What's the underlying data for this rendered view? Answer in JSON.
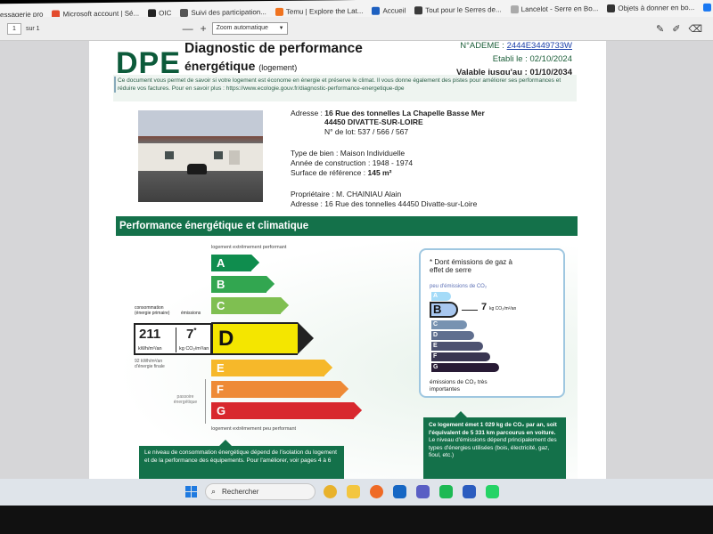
{
  "bookmarks": [
    {
      "label": "essagerie pro",
      "color": "#2f73c9"
    },
    {
      "label": "Microsoft account | Sé...",
      "color": "#e34b2d"
    },
    {
      "label": "OIC",
      "color": "#222222"
    },
    {
      "label": "Suivi des participation...",
      "color": "#555555"
    },
    {
      "label": "Temu | Explore the Lat...",
      "color": "#f0731f"
    },
    {
      "label": "Accueil",
      "color": "#1e60c0"
    },
    {
      "label": "Tout pour le Serres de...",
      "color": "#3a3a3a"
    },
    {
      "label": "Lancelot - Serre en Bo...",
      "color": "#aaaaaa"
    },
    {
      "label": "Objets à donner en bo...",
      "color": "#333333"
    },
    {
      "label": "Facebook",
      "color": "#1877f2"
    }
  ],
  "pdf_toolbar": {
    "page_number": "1",
    "page_of": "sur 1",
    "zoom_out": "—",
    "zoom_in": "+",
    "zoom": "Zoom automatique"
  },
  "document": {
    "logo": "DPE",
    "title_line1": "Diagnostic de performance",
    "title_line2": "énergétique",
    "title_sub": "(logement)",
    "ademe_label": "N°ADEME :",
    "ademe_value": "2444E3449733W",
    "etabli": "Etabli le : 02/10/2024",
    "valable": "Valable jusqu'au : 01/10/2034",
    "intro": "Ce document vous permet de savoir si votre logement est économe en énergie et préserve le climat. Il vous donne également des pistes pour améliorer ses performances et réduire vos factures. Pour en savoir plus : https://www.ecologie.gouv.fr/diagnostic-performance-energetique-dpe",
    "address_label": "Adresse :",
    "address_line1": "16 Rue des tonnelles La Chapelle Basse Mer",
    "address_line2": "44450 DIVATTE-SUR-LOIRE",
    "lot": "N° de lot: 537 / 566 / 567",
    "type_bien_label": "Type de bien :",
    "type_bien": "Maison Individuelle",
    "annee_label": "Année de construction :",
    "annee": "1948 - 1974",
    "surface_label": "Surface de référence :",
    "surface": "145 m²",
    "proprio_label": "Propriétaire :",
    "proprio": "M. CHAINIAU Alain",
    "address2_label": "Adresse :",
    "address2": "16 Rue des tonnelles 44450 Divatte-sur-Loire"
  },
  "performance": {
    "band_title": "Performance énergétique et climatique",
    "top_label": "logement extrêmement performant",
    "bottom_label": "logement extrêmement peu performant",
    "classes": [
      {
        "letter": "A",
        "color": "#0f8d4e"
      },
      {
        "letter": "B",
        "color": "#32a650"
      },
      {
        "letter": "C",
        "color": "#7fbf51"
      },
      {
        "letter": "D",
        "color": "#f4e600"
      },
      {
        "letter": "E",
        "color": "#f6b82a"
      },
      {
        "letter": "F",
        "color": "#ee8a37"
      },
      {
        "letter": "G",
        "color": "#d8282e"
      }
    ],
    "current_class": "D",
    "consumption_label": "consommation (énergie primaire)",
    "emissions_label": "émissions",
    "consumption_value": "211",
    "consumption_unit": "kWh/m²/an",
    "emissions_value": "7",
    "emissions_mark": "*",
    "emissions_unit": "kg CO₂/m²/an",
    "final_label": "92 kWh/m²/an d'énergie finale",
    "passoire_label": "passoire énergétique",
    "note_left": "Le niveau de consommation énergétique dépend de l'isolation du logement et de la performance des équipements. Pour l'améliorer, voir pages 4 à 6"
  },
  "ges": {
    "title": "* Dont émissions de gaz à effet de serre",
    "top_label": "peu d'émissions de CO₂",
    "classes": [
      {
        "letter": "A",
        "color": "#a4dbf8"
      },
      {
        "letter": "B",
        "color": "#8cb4d3"
      },
      {
        "letter": "C",
        "color": "#7792b1"
      },
      {
        "letter": "D",
        "color": "#606f8f"
      },
      {
        "letter": "E",
        "color": "#4d5271"
      },
      {
        "letter": "F",
        "color": "#393551"
      },
      {
        "letter": "G",
        "color": "#281b35"
      }
    ],
    "current_class": "B",
    "value": "7",
    "unit": "kg CO₂/m²/an",
    "bottom_label": "émissions de CO₂ très importantes",
    "note_bold": "Ce logement émet 1 029 kg de CO₂ par an, soit l'équivalent de 5 331 km parcourus en voiture.",
    "note_rest": "Le niveau d'émissions dépend principalement des types d'énergies utilisées (bois, électricité, gaz, fioul, etc.)"
  },
  "taskbar": {
    "search_placeholder": "Rechercher",
    "apps": [
      {
        "name": "chrome-icon",
        "color": "#e8b22c"
      },
      {
        "name": "file-explorer-icon",
        "color": "#f3c640"
      },
      {
        "name": "firefox-icon",
        "color": "#ef6a25"
      },
      {
        "name": "outlook-icon",
        "color": "#1667c4"
      },
      {
        "name": "teams-icon",
        "color": "#5a5fc4"
      },
      {
        "name": "spotify-icon",
        "color": "#1db954"
      },
      {
        "name": "word-icon",
        "color": "#2b5cbf"
      },
      {
        "name": "whatsapp-icon",
        "color": "#25d366"
      }
    ]
  }
}
